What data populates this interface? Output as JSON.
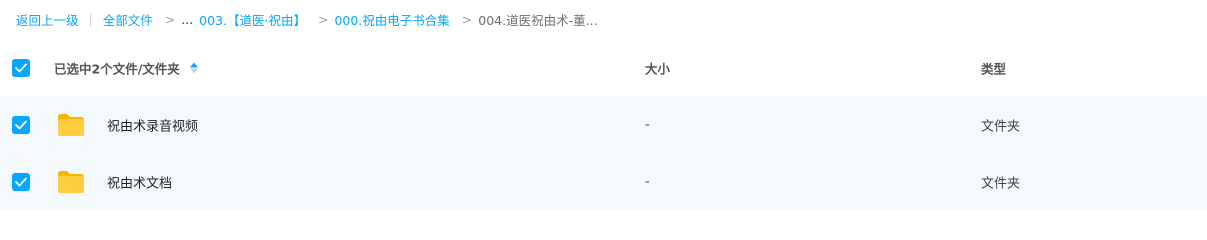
{
  "breadcrumb": {
    "back": "返回上一级",
    "separator": "|",
    "all_files": "全部文件",
    "arrow": ">",
    "ellipsis": "...",
    "items": [
      "003.【道医·祝由】",
      "000.祝由电子书合集"
    ],
    "current": "004.道医祝由术-董..."
  },
  "table": {
    "header": {
      "selection_label": "已选中2个文件/文件夹",
      "size_label": "大小",
      "type_label": "类型"
    },
    "rows": [
      {
        "name": "祝由术录音视频",
        "size": "-",
        "type": "文件夹",
        "checked": true
      },
      {
        "name": "祝由术文档",
        "size": "-",
        "type": "文件夹",
        "checked": true
      }
    ]
  },
  "colors": {
    "accent": "#06a7ff",
    "row_selected_bg": "#f3f9fc",
    "folder_yellow": "#ffc928"
  },
  "icons": {
    "checkbox": "check-icon",
    "sort": "sort-icon",
    "folder": "folder-icon"
  }
}
